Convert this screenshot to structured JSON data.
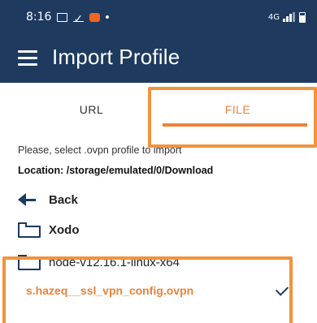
{
  "status_bar": {
    "time": "8:16",
    "network": "4G"
  },
  "app_bar": {
    "title": "Import Profile"
  },
  "tabs": [
    {
      "label": "URL",
      "selected": false
    },
    {
      "label": "FILE",
      "selected": true
    }
  ],
  "prompt": "Please, select .ovpn profile to import",
  "location": "Location: /storage/emulated/0/Download",
  "file_list": {
    "back_label": "Back",
    "items": [
      {
        "label": "Xodo",
        "type": "folder"
      },
      {
        "label": "node-v12.16.1-linux-x64",
        "type": "folder"
      },
      {
        "label": "s.hazeq__ssl_vpn_config.ovpn",
        "type": "file",
        "selected": true
      }
    ]
  },
  "colors": {
    "header": "#1e3a5f",
    "accent": "#e8833a",
    "highlight_box": "#f0933e"
  }
}
